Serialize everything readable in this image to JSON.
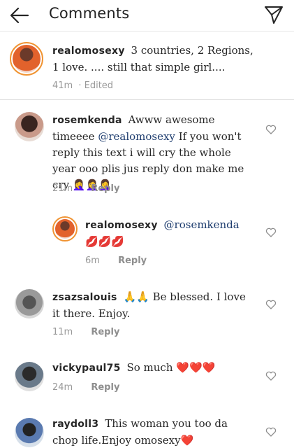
{
  "header": {
    "title": "Comments"
  },
  "caption": {
    "username": "realomosexy",
    "text": "3 countries, 2 Regions, 1 love. .... still that simple girl....",
    "time": "41m",
    "edited": "· Edited"
  },
  "comments": [
    {
      "username": "rosemkenda",
      "text_before": "Awww awesome timeeee ",
      "mention": "@realomosexy",
      "text_after": " If you won't reply this text i will cry the whole year ooo plis jus reply don make me cry",
      "emoji": "🤦‍♀️🤦‍♀️🤦‍♀️",
      "time": "21m",
      "reply_label": "Reply"
    },
    {
      "username": "realomosexy",
      "text_before": "",
      "mention": "@rosemkenda",
      "text_after": "",
      "emoji": "💋💋💋",
      "time": "6m",
      "reply_label": "Reply"
    },
    {
      "username": "zsazsalouis",
      "text_before": "🙏🙏 Be blessed. I love it there. Enjoy.",
      "time": "11m",
      "reply_label": "Reply"
    },
    {
      "username": "vickypaul75",
      "text_before": "So much ",
      "emoji": "❤️❤️❤️",
      "time": "24m",
      "reply_label": "Reply"
    },
    {
      "username": "raydoll3",
      "text_before": "This woman you too da chop life.Enjoy omosexy",
      "emoji": "❤️"
    }
  ],
  "colors": {
    "accent": "#1d3c6e",
    "ring": "#f09433",
    "heart": "#d0021b"
  }
}
